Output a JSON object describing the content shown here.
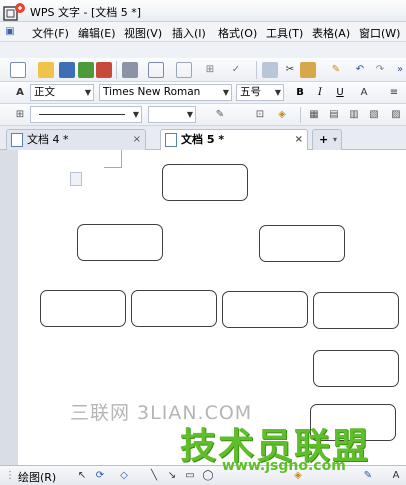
{
  "window": {
    "title": "WPS 文字 - [文档 5 *]"
  },
  "menu": {
    "items": [
      "文件(F)",
      "编辑(E)",
      "视图(V)",
      "插入(I)",
      "格式(O)",
      "工具(T)",
      "表格(A)",
      "窗口(W)"
    ]
  },
  "format_toolbar": {
    "style": "正文",
    "font": "Times New Roman",
    "size": "五号",
    "bold": "B",
    "italic": "I",
    "underline": "U"
  },
  "tabs": [
    {
      "label": "文档 4 *",
      "active": false
    },
    {
      "label": "文档 5 *",
      "active": true
    }
  ],
  "tab_add_label": "+",
  "drawing_toolbar": {
    "label": "绘图(R)"
  },
  "watermarks": {
    "line1": "三联网 3LIAN.COM",
    "line2": "技术员联盟",
    "line3": "www.jsgho.com"
  },
  "diagram": {
    "box_count": 10,
    "box_style": "rounded rectangle, empty"
  },
  "colors": {
    "accent_green": "#5fbf2b",
    "toolbar_bg": "#eceff4",
    "workspace_bg": "#d9dde4"
  }
}
